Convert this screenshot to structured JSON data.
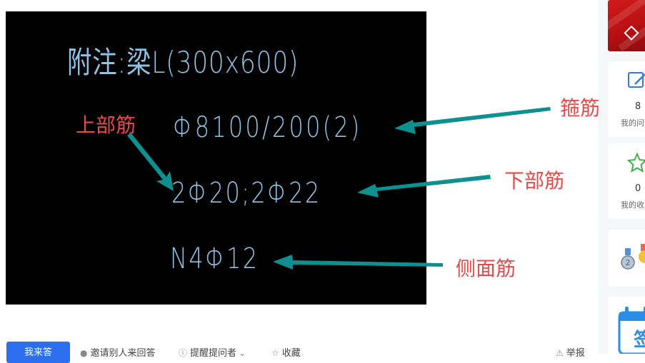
{
  "cad": {
    "title": "附注:梁L(300x600)",
    "stirrup_spec": "Φ8100/200(2)",
    "bottom_spec": "2Φ20;2Φ22",
    "side_spec": "N4Φ12"
  },
  "annotations": {
    "top_rebar": "上部筋",
    "stirrup": "箍筋",
    "lower_rebar": "下部筋",
    "side_rebar": "侧面筋",
    "arrow_color": "#0f9090",
    "label_color": "#e84a4a"
  },
  "sidebar": {
    "questions": {
      "count": "8",
      "label": "我的问",
      "icon": "edit-icon"
    },
    "favorites": {
      "count": "0",
      "label": "我的收",
      "icon": "star-icon"
    },
    "medals_icon": "medal-icon",
    "checkin": {
      "label": "签",
      "icon": "calendar-icon"
    }
  },
  "toolbar": {
    "answer": "我来答",
    "invite": "邀请别人来回答",
    "remind": "提醒提问者",
    "favorite": "收藏",
    "report": "举报"
  }
}
